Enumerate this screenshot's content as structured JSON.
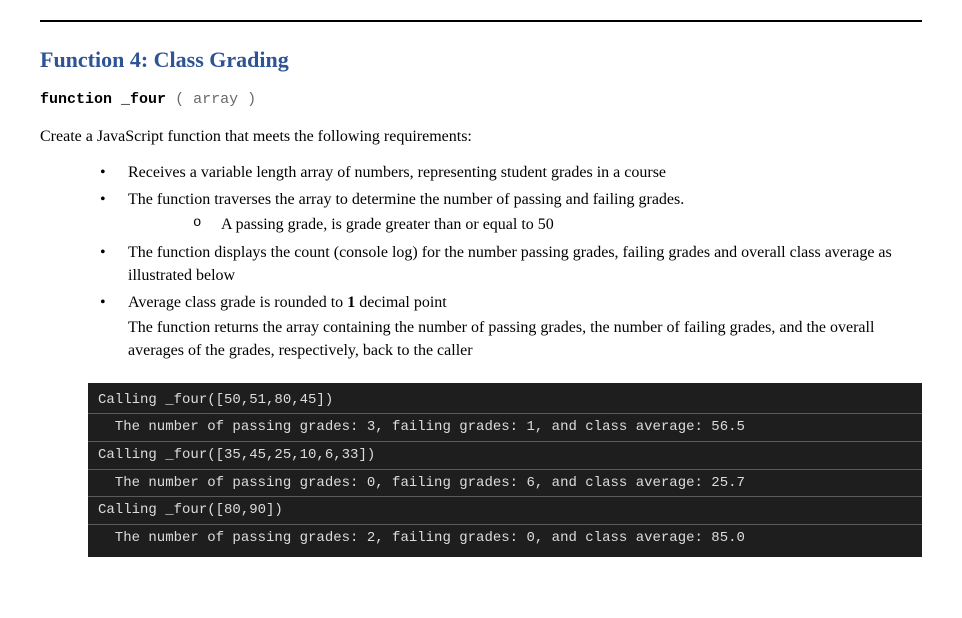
{
  "title": "Function 4: Class Grading",
  "signature": {
    "keyword": "function",
    "name": "_four",
    "params": "( array )"
  },
  "intro": "Create a JavaScript function that meets the following requirements:",
  "bullets": {
    "b1": "Receives a variable length array of numbers, representing student grades in a course",
    "b2": "The function traverses the array to determine the number of passing and failing grades.",
    "b2_sub": "A passing grade, is grade greater than or equal to 50",
    "b3": "The function displays the count (console log) for the number passing grades, failing grades and overall class average as illustrated below",
    "b4_prefix": "Average class grade is rounded to ",
    "b4_bold": "1",
    "b4_suffix": " decimal point",
    "b4_cont": "The function returns the array containing the number of passing grades, the number of failing grades, and the overall averages of the grades, respectively, back to the caller"
  },
  "console": {
    "l1": "Calling _four([50,51,80,45])",
    "l2": "  The number of passing grades: 3, failing grades: 1, and class average: 56.5",
    "l3": "Calling _four([35,45,25,10,6,33])",
    "l4": "  The number of passing grades: 0, failing grades: 6, and class average: 25.7",
    "l5": "Calling _four([80,90])",
    "l6": "  The number of passing grades: 2, failing grades: 0, and class average: 85.0"
  }
}
